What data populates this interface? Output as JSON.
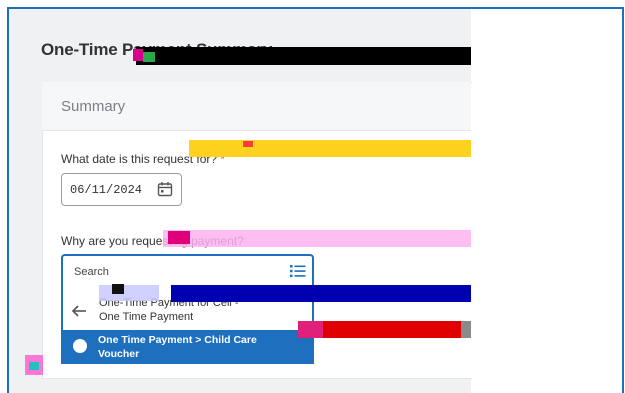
{
  "page": {
    "title": "One-Time Payment Summary"
  },
  "summary": {
    "section_title": "Summary",
    "date_question": "What date is this request for?",
    "required_mark": "*",
    "date_value": "06/11/2024",
    "reason_question": "Why are you requesting payment?"
  },
  "dropdown": {
    "search_placeholder": "Search",
    "back_label_line1": "One-Time Payment for Cell -",
    "back_label_line2": "One Time Payment",
    "options": [
      {
        "label": "One Time Payment > Child Care Voucher",
        "selected": true
      }
    ]
  },
  "colors": {
    "accent": "#1f6fbf",
    "required": "#d93025"
  },
  "icons": {
    "date": "calendar-icon",
    "list": "list-icon",
    "back": "arrow-left-icon",
    "radio": "radio-icon"
  }
}
